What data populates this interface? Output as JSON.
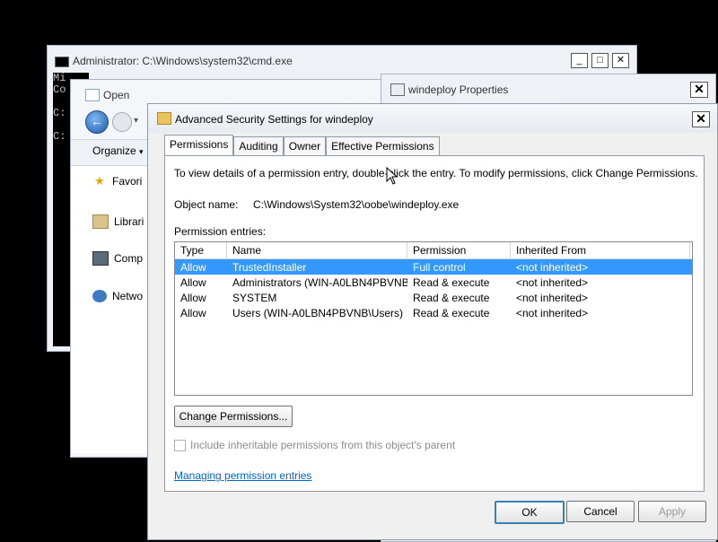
{
  "cmd": {
    "title": "Administrator: C:\\Windows\\system32\\cmd.exe",
    "lines": [
      "Mi",
      "Co",
      "",
      "C:",
      "",
      "C:"
    ]
  },
  "open": {
    "title": "Open",
    "organize": "Organize",
    "nav": [
      "Favori",
      "Librari",
      "Comp",
      "Netwo"
    ]
  },
  "props": {
    "title": "windeploy Properties"
  },
  "adv": {
    "title": "Advanced Security Settings for windeploy",
    "tabs": [
      "Permissions",
      "Auditing",
      "Owner",
      "Effective Permissions"
    ],
    "info": "To view details of a permission entry, double-click the entry. To modify permissions, click Change Permissions.",
    "object_label": "Object name:",
    "object_value": "C:\\Windows\\System32\\oobe\\windeploy.exe",
    "entries_label": "Permission entries:",
    "columns": [
      "Type",
      "Name",
      "Permission",
      "Inherited From"
    ],
    "rows": [
      {
        "type": "Allow",
        "name": "TrustedInstaller",
        "permission": "Full control",
        "inherited": "<not inherited>"
      },
      {
        "type": "Allow",
        "name": "Administrators (WIN-A0LBN4PBVNB\\...",
        "permission": "Read & execute",
        "inherited": "<not inherited>"
      },
      {
        "type": "Allow",
        "name": "SYSTEM",
        "permission": "Read & execute",
        "inherited": "<not inherited>"
      },
      {
        "type": "Allow",
        "name": "Users (WIN-A0LBN4PBVNB\\Users)",
        "permission": "Read & execute",
        "inherited": "<not inherited>"
      }
    ],
    "change_button": "Change Permissions...",
    "inherit_checkbox": "Include inheritable permissions from this object's parent",
    "help_link": "Managing permission entries",
    "ok": "OK",
    "cancel": "Cancel",
    "apply": "Apply"
  }
}
